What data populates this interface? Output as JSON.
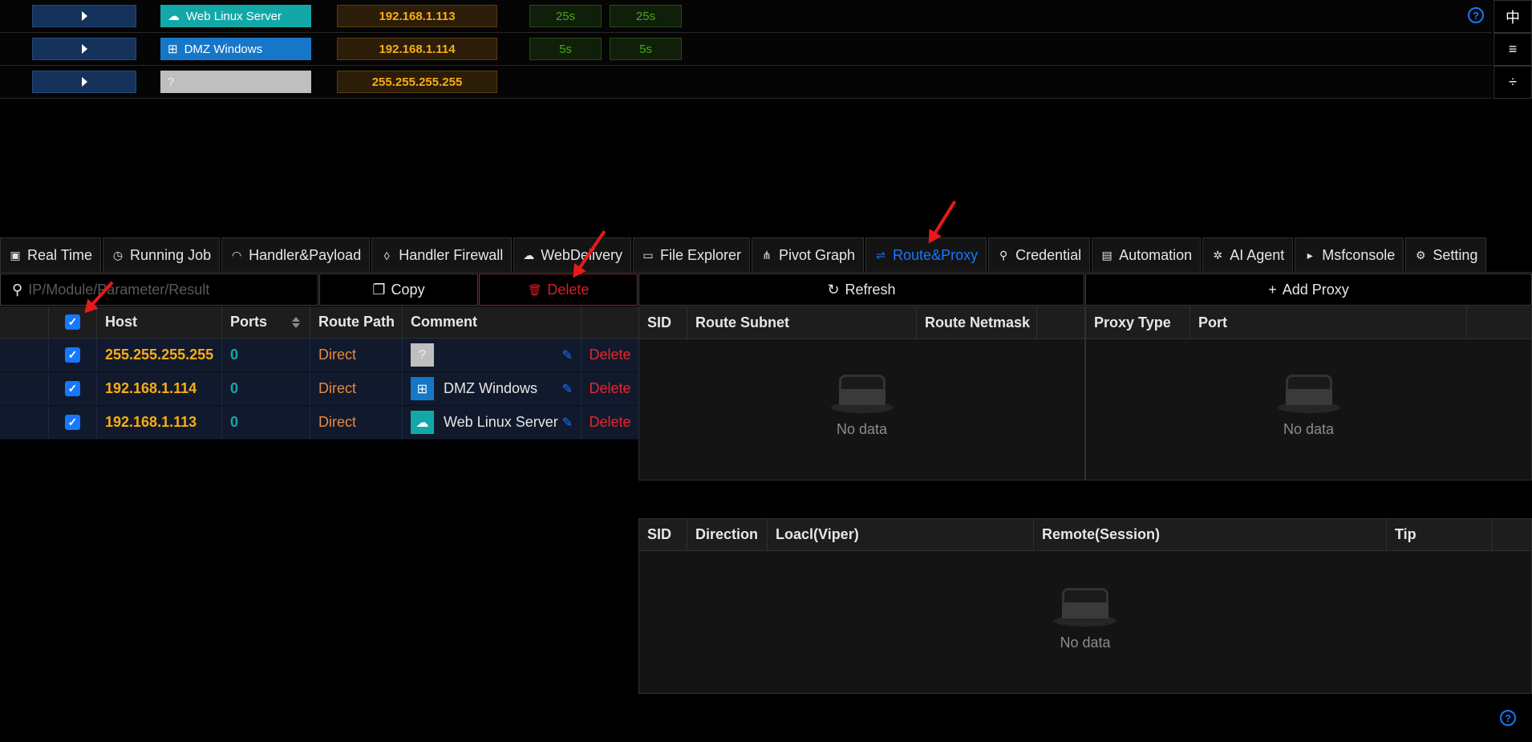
{
  "sessions": [
    {
      "host_label": "Web Linux Server",
      "host_icon": "☁",
      "ip": "192.168.1.113",
      "time_a": "25s",
      "time_b": "25s"
    },
    {
      "host_label": "DMZ Windows",
      "host_icon": "⊞",
      "ip": "192.168.1.114",
      "time_a": "5s",
      "time_b": "5s"
    },
    {
      "host_label": "",
      "host_icon": "?",
      "ip": "255.255.255.255",
      "time_a": "",
      "time_b": ""
    }
  ],
  "side_buttons": {
    "lang": "中",
    "align": "≡",
    "split": "÷"
  },
  "help_icon": "?",
  "tabs": [
    {
      "label": "Real Time",
      "icon": "▣"
    },
    {
      "label": "Running Job",
      "icon": "◷"
    },
    {
      "label": "Handler&Payload",
      "icon": "◠"
    },
    {
      "label": "Handler Firewall",
      "icon": "◊"
    },
    {
      "label": "WebDelivery",
      "icon": "☁"
    },
    {
      "label": "File Explorer",
      "icon": "▭"
    },
    {
      "label": "Pivot Graph",
      "icon": "⋔"
    },
    {
      "label": "Route&Proxy",
      "icon": "⇌"
    },
    {
      "label": "Credential",
      "icon": "⚲"
    },
    {
      "label": "Automation",
      "icon": "▤"
    },
    {
      "label": "AI Agent",
      "icon": "✲"
    },
    {
      "label": "Msfconsole",
      "icon": "▸"
    },
    {
      "label": "Setting",
      "icon": "⚙"
    }
  ],
  "toolbar": {
    "search_placeholder": "IP/Module/Parameter/Result",
    "search_icon": "⚲",
    "copy_icon": "❐",
    "copy_label": "Copy",
    "delete_icon": "🗑",
    "delete_label": "Delete",
    "refresh_icon": "↻",
    "refresh_label": "Refresh",
    "add_proxy_icon": "+",
    "add_proxy_label": "Add Proxy"
  },
  "host_table": {
    "headers": {
      "host": "Host",
      "ports": "Ports",
      "route_path": "Route Path",
      "comment": "Comment"
    },
    "rows": [
      {
        "host": "255.255.255.255",
        "ports": "0",
        "route": "Direct",
        "comment": "",
        "icon": "?",
        "delete": "Delete"
      },
      {
        "host": "192.168.1.114",
        "ports": "0",
        "route": "Direct",
        "comment": "DMZ Windows",
        "icon": "⊞",
        "delete": "Delete"
      },
      {
        "host": "192.168.1.113",
        "ports": "0",
        "route": "Direct",
        "comment": "Web Linux Server",
        "icon": "☁",
        "delete": "Delete"
      }
    ],
    "check": "✓",
    "edit_icon": "✎"
  },
  "route_table": {
    "sid": "SID",
    "subnet": "Route Subnet",
    "netmask": "Route Netmask",
    "empty": "No data"
  },
  "proxy_table": {
    "type": "Proxy Type",
    "port": "Port",
    "empty": "No data"
  },
  "portfwd_table": {
    "sid": "SID",
    "direction": "Direction",
    "local": "Loacl(Viper)",
    "remote": "Remote(Session)",
    "tip": "Tip",
    "empty": "No data"
  }
}
